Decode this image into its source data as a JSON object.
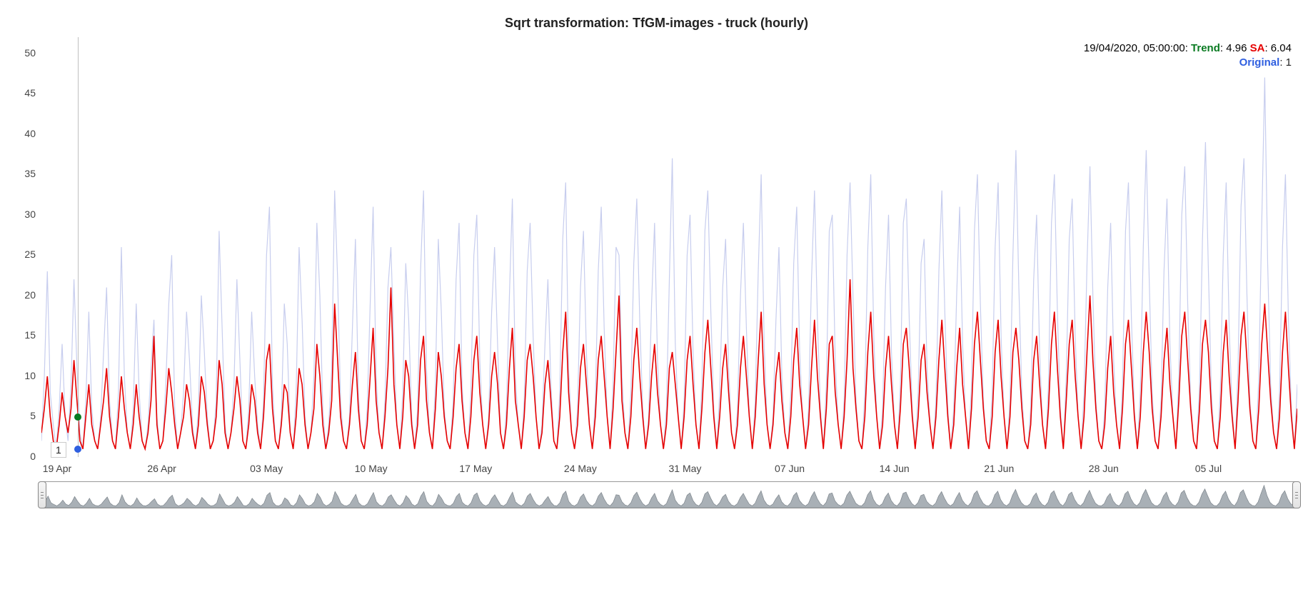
{
  "chart_data": {
    "type": "line",
    "title": "Sqrt transformation: TfGM-images - truck (hourly)",
    "xlabel": "",
    "ylabel": "",
    "ylim": [
      0,
      52
    ],
    "x_ticks": [
      "19 Apr",
      "26 Apr",
      "03 May",
      "10 May",
      "17 May",
      "24 May",
      "31 May",
      "07 Jun",
      "14 Jun",
      "21 Jun",
      "28 Jun",
      "05 Jul"
    ],
    "hover": {
      "timestamp": "19/04/2020, 05:00:00",
      "trend_label": "Trend",
      "trend_value": "4.96",
      "sa_label": "SA",
      "sa_value": "6.04",
      "original_label": "Original",
      "original_value": "1"
    },
    "tooltip_value": "1",
    "colors": {
      "original": "#c7cdee",
      "trend_point": "#0a7b22",
      "sa": "#e60000",
      "original_point": "#2f5fe0",
      "nav_fill": "#a9b0b6"
    },
    "cursor_x_fraction": 0.029,
    "series": [
      {
        "name": "Original",
        "color": "#c7cdee",
        "values": [
          2,
          10,
          23,
          8,
          4,
          1,
          6,
          14,
          5,
          2,
          9,
          22,
          11,
          3,
          1,
          7,
          18,
          6,
          2,
          1,
          5,
          13,
          21,
          7,
          2,
          1,
          8,
          26,
          10,
          3,
          1,
          6,
          19,
          8,
          2,
          1,
          4,
          11,
          17,
          5,
          1,
          2,
          9,
          19,
          25,
          6,
          1,
          3,
          8,
          18,
          12,
          4,
          1,
          6,
          20,
          13,
          5,
          1,
          2,
          7,
          28,
          16,
          4,
          1,
          3,
          9,
          22,
          12,
          2,
          1,
          6,
          18,
          10,
          4,
          1,
          7,
          25,
          31,
          9,
          2,
          1,
          5,
          19,
          14,
          3,
          1,
          8,
          26,
          17,
          5,
          1,
          3,
          10,
          29,
          20,
          6,
          1,
          4,
          11,
          33,
          22,
          7,
          2,
          1,
          5,
          16,
          27,
          8,
          2,
          1,
          6,
          19,
          31,
          10,
          3,
          1,
          7,
          21,
          26,
          14,
          4,
          1,
          8,
          24,
          17,
          5,
          1,
          6,
          23,
          33,
          11,
          3,
          1,
          9,
          27,
          18,
          6,
          2,
          1,
          7,
          22,
          29,
          9,
          3,
          1,
          8,
          25,
          30,
          12,
          4,
          1,
          5,
          18,
          26,
          14,
          3,
          1,
          6,
          20,
          32,
          10,
          4,
          1,
          7,
          23,
          29,
          15,
          5,
          1,
          4,
          14,
          22,
          9,
          2,
          1,
          8,
          27,
          34,
          11,
          3,
          1,
          6,
          21,
          28,
          13,
          4,
          1,
          7,
          23,
          31,
          16,
          5,
          1,
          9,
          26,
          25,
          10,
          3,
          1,
          8,
          24,
          32,
          17,
          6,
          1,
          5,
          19,
          29,
          12,
          4,
          1,
          6,
          22,
          37,
          14,
          5,
          1,
          7,
          25,
          30,
          13,
          4,
          1,
          9,
          28,
          33,
          18,
          6,
          1,
          8,
          21,
          27,
          11,
          3,
          1,
          6,
          20,
          29,
          16,
          5,
          1,
          7,
          23,
          35,
          14,
          4,
          1,
          5,
          17,
          26,
          10,
          3,
          1,
          8,
          24,
          31,
          13,
          5,
          1,
          6,
          22,
          33,
          17,
          6,
          1,
          9,
          28,
          30,
          12,
          4,
          1,
          7,
          25,
          34,
          20,
          7,
          2,
          1,
          8,
          26,
          35,
          15,
          5,
          1,
          6,
          21,
          30,
          13,
          4,
          1,
          9,
          29,
          32,
          17,
          6,
          1,
          8,
          24,
          27,
          11,
          4,
          1,
          7,
          23,
          33,
          18,
          6,
          1,
          6,
          20,
          31,
          14,
          5,
          1,
          9,
          28,
          35,
          19,
          7,
          2,
          1,
          8,
          26,
          34,
          15,
          5,
          1,
          7,
          25,
          38,
          21,
          8,
          2,
          1,
          6,
          22,
          30,
          13,
          4,
          1,
          9,
          29,
          35,
          18,
          6,
          1,
          10,
          27,
          32,
          15,
          5,
          1,
          8,
          24,
          36,
          20,
          7,
          2,
          1,
          6,
          21,
          29,
          12,
          4,
          1,
          9,
          28,
          34,
          17,
          6,
          1,
          8,
          26,
          38,
          22,
          8,
          2,
          1,
          7,
          23,
          32,
          14,
          5,
          1,
          10,
          30,
          36,
          19,
          7,
          2,
          1,
          9,
          27,
          39,
          23,
          8,
          2,
          1,
          8,
          25,
          34,
          16,
          6,
          1,
          11,
          31,
          37,
          20,
          7,
          2,
          1,
          10,
          29,
          47,
          24,
          9,
          3,
          1,
          8,
          26,
          35,
          17,
          6,
          1,
          9
        ]
      },
      {
        "name": "SA",
        "color": "#e60000",
        "values": [
          3,
          6,
          10,
          5,
          2,
          1,
          4,
          8,
          5,
          3,
          6,
          12,
          7,
          2,
          1,
          5,
          9,
          4,
          2,
          1,
          4,
          7,
          11,
          5,
          2,
          1,
          5,
          10,
          6,
          3,
          1,
          4,
          9,
          5,
          2,
          1,
          3,
          7,
          15,
          4,
          1,
          2,
          6,
          11,
          8,
          4,
          1,
          3,
          5,
          9,
          7,
          3,
          1,
          4,
          10,
          8,
          4,
          1,
          2,
          5,
          12,
          9,
          3,
          1,
          3,
          6,
          10,
          7,
          2,
          1,
          4,
          9,
          7,
          3,
          1,
          5,
          12,
          14,
          6,
          2,
          1,
          4,
          9,
          8,
          3,
          1,
          5,
          11,
          9,
          4,
          1,
          3,
          6,
          14,
          10,
          4,
          1,
          3,
          7,
          19,
          12,
          5,
          2,
          1,
          4,
          9,
          13,
          6,
          2,
          1,
          4,
          10,
          16,
          7,
          3,
          1,
          5,
          11,
          21,
          9,
          4,
          1,
          5,
          12,
          10,
          4,
          1,
          4,
          12,
          15,
          7,
          3,
          1,
          6,
          13,
          10,
          5,
          2,
          1,
          5,
          11,
          14,
          7,
          3,
          1,
          5,
          12,
          15,
          8,
          4,
          1,
          4,
          10,
          13,
          9,
          3,
          1,
          4,
          11,
          16,
          7,
          4,
          1,
          5,
          12,
          14,
          10,
          5,
          1,
          3,
          9,
          12,
          7,
          2,
          1,
          5,
          13,
          18,
          8,
          3,
          1,
          4,
          11,
          14,
          9,
          4,
          1,
          5,
          12,
          15,
          10,
          5,
          1,
          6,
          13,
          20,
          7,
          3,
          1,
          5,
          12,
          16,
          10,
          5,
          1,
          4,
          10,
          14,
          8,
          4,
          1,
          4,
          11,
          13,
          9,
          5,
          1,
          5,
          12,
          15,
          9,
          4,
          1,
          6,
          13,
          17,
          11,
          5,
          1,
          5,
          11,
          14,
          8,
          3,
          1,
          4,
          11,
          15,
          10,
          5,
          1,
          5,
          12,
          18,
          9,
          4,
          1,
          4,
          10,
          13,
          7,
          3,
          1,
          5,
          12,
          16,
          9,
          5,
          1,
          4,
          11,
          17,
          10,
          5,
          1,
          6,
          14,
          15,
          8,
          4,
          1,
          5,
          12,
          22,
          11,
          6,
          2,
          1,
          5,
          13,
          18,
          10,
          5,
          1,
          4,
          11,
          15,
          9,
          4,
          1,
          6,
          14,
          16,
          11,
          5,
          1,
          5,
          12,
          14,
          8,
          4,
          1,
          5,
          12,
          17,
          11,
          5,
          1,
          4,
          11,
          16,
          9,
          5,
          1,
          6,
          14,
          18,
          12,
          6,
          2,
          1,
          5,
          13,
          17,
          10,
          5,
          1,
          5,
          13,
          16,
          12,
          6,
          2,
          1,
          4,
          12,
          15,
          9,
          4,
          1,
          6,
          14,
          18,
          11,
          5,
          1,
          7,
          14,
          17,
          10,
          5,
          1,
          5,
          13,
          20,
          12,
          6,
          2,
          1,
          4,
          11,
          15,
          8,
          4,
          1,
          6,
          14,
          17,
          11,
          5,
          1,
          5,
          13,
          18,
          13,
          6,
          2,
          1,
          5,
          12,
          16,
          9,
          5,
          1,
          7,
          15,
          18,
          12,
          6,
          2,
          1,
          6,
          14,
          17,
          13,
          6,
          2,
          1,
          5,
          13,
          17,
          10,
          5,
          1,
          7,
          15,
          18,
          12,
          6,
          2,
          1,
          6,
          14,
          19,
          13,
          7,
          3,
          1,
          5,
          13,
          18,
          11,
          5,
          1,
          6
        ]
      }
    ]
  }
}
